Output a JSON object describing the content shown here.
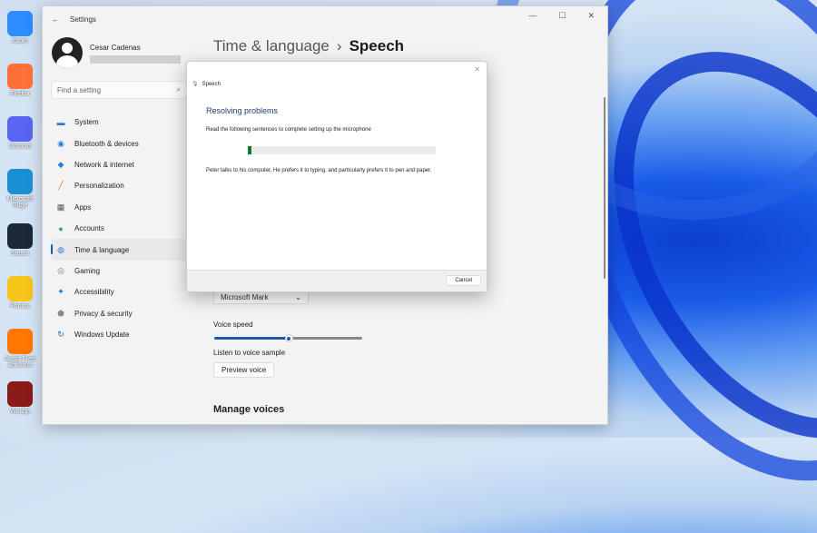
{
  "desktop": {
    "icons": [
      {
        "label": "Zoom",
        "color": "#2d8cff"
      },
      {
        "label": "Firefox",
        "color": "#ff7139"
      },
      {
        "label": "Discord",
        "color": "#5865f2"
      },
      {
        "label": "Microsoft Edge",
        "color": "#1b8fd4"
      },
      {
        "label": "Steam",
        "color": "#1b2838"
      },
      {
        "label": "Photos",
        "color": "#f5c518"
      },
      {
        "label": "Avast Free Antivirus",
        "color": "#ff7800"
      },
      {
        "label": "WinZip",
        "color": "#8b1a1a"
      }
    ]
  },
  "window": {
    "title": "Settings",
    "back": "←",
    "minimize": "—",
    "maximize": "☐",
    "close": "✕"
  },
  "user": {
    "name": "Cesar Cadenas"
  },
  "search": {
    "placeholder": "Find a setting",
    "icon": "⌕"
  },
  "nav": [
    {
      "label": "System",
      "icon": "▬",
      "color": "#2b7cd3"
    },
    {
      "label": "Bluetooth & devices",
      "icon": "◉",
      "color": "#2b7cd3"
    },
    {
      "label": "Network & internet",
      "icon": "◆",
      "color": "#2b7cd3"
    },
    {
      "label": "Personalization",
      "icon": "╱",
      "color": "#d2693c"
    },
    {
      "label": "Apps",
      "icon": "▦",
      "color": "#555"
    },
    {
      "label": "Accounts",
      "icon": "●",
      "color": "#2aa876"
    },
    {
      "label": "Time & language",
      "icon": "◍",
      "color": "#2b7cd3"
    },
    {
      "label": "Gaming",
      "icon": "◎",
      "color": "#777"
    },
    {
      "label": "Accessibility",
      "icon": "✦",
      "color": "#1b6fc0"
    },
    {
      "label": "Privacy & security",
      "icon": "⬟",
      "color": "#888"
    },
    {
      "label": "Windows Update",
      "icon": "↻",
      "color": "#1b6fc0"
    }
  ],
  "header": {
    "parent": "Time & language",
    "sep": "›",
    "current": "Speech"
  },
  "content": {
    "voice": "Microsoft Mark",
    "voice_speed_label": "Voice speed",
    "voice_speed": 50,
    "listen_label": "Listen to voice sample",
    "preview_button": "Preview voice",
    "manage_voices": "Manage voices"
  },
  "dialog": {
    "title": "Speech",
    "heading": "Resolving problems",
    "instruction": "Read the following sentences to complete setting up the microphone",
    "progress": 2,
    "sentence": "Peter talks to his computer. He prefers it to typing, and particularly prefers it to pen and paper.",
    "cancel": "Cancel",
    "close": "✕"
  }
}
